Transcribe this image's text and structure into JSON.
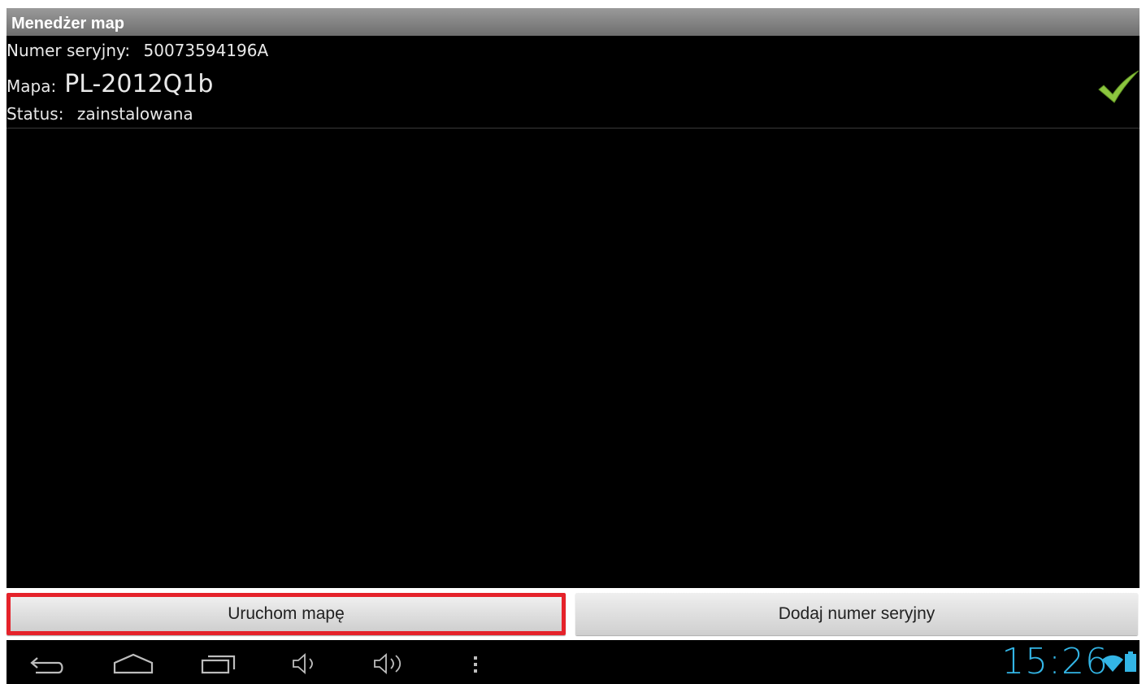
{
  "titlebar": {
    "title": "Menedżer map"
  },
  "info": {
    "serial_label": "Numer seryjny:",
    "serial_value": "50073594196A",
    "map_label": "Mapa:",
    "map_value": "PL-2012Q1b",
    "status_label": "Status:",
    "status_value": "zainstalowana"
  },
  "buttons": {
    "run_map": "Uruchom mapę",
    "add_serial": "Dodaj numer seryjny"
  },
  "statusbar": {
    "time": "15:26",
    "accent_color": "#33b5e5"
  },
  "icons": {
    "status": "checkmark-icon",
    "nav": [
      "back-icon",
      "home-icon",
      "recent-apps-icon",
      "volume-down-icon",
      "volume-up-icon",
      "menu-icon"
    ],
    "system": [
      "wifi-icon",
      "battery-icon"
    ]
  },
  "highlight_color": "#e5222a"
}
